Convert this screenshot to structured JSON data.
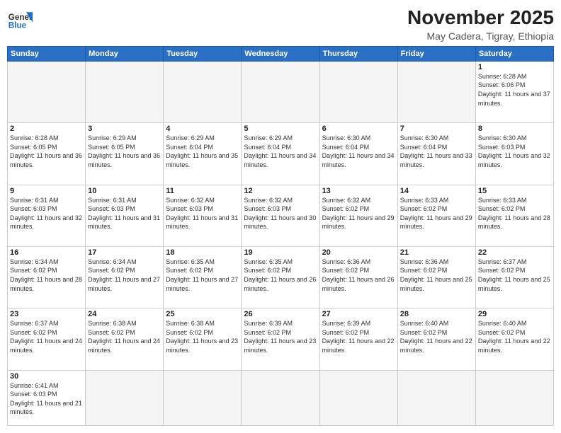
{
  "header": {
    "logo_general": "General",
    "logo_blue": "Blue",
    "month_title": "November 2025",
    "location": "May Cadera, Tigray, Ethiopia"
  },
  "days_of_week": [
    "Sunday",
    "Monday",
    "Tuesday",
    "Wednesday",
    "Thursday",
    "Friday",
    "Saturday"
  ],
  "weeks": [
    [
      null,
      null,
      null,
      null,
      null,
      null,
      {
        "day": "1",
        "sunrise": "Sunrise: 6:28 AM",
        "sunset": "Sunset: 6:06 PM",
        "daylight": "Daylight: 11 hours and 37 minutes."
      }
    ],
    [
      {
        "day": "2",
        "sunrise": "Sunrise: 6:28 AM",
        "sunset": "Sunset: 6:05 PM",
        "daylight": "Daylight: 11 hours and 36 minutes."
      },
      {
        "day": "3",
        "sunrise": "Sunrise: 6:29 AM",
        "sunset": "Sunset: 6:05 PM",
        "daylight": "Daylight: 11 hours and 36 minutes."
      },
      {
        "day": "4",
        "sunrise": "Sunrise: 6:29 AM",
        "sunset": "Sunset: 6:04 PM",
        "daylight": "Daylight: 11 hours and 35 minutes."
      },
      {
        "day": "5",
        "sunrise": "Sunrise: 6:29 AM",
        "sunset": "Sunset: 6:04 PM",
        "daylight": "Daylight: 11 hours and 34 minutes."
      },
      {
        "day": "6",
        "sunrise": "Sunrise: 6:30 AM",
        "sunset": "Sunset: 6:04 PM",
        "daylight": "Daylight: 11 hours and 34 minutes."
      },
      {
        "day": "7",
        "sunrise": "Sunrise: 6:30 AM",
        "sunset": "Sunset: 6:04 PM",
        "daylight": "Daylight: 11 hours and 33 minutes."
      },
      {
        "day": "8",
        "sunrise": "Sunrise: 6:30 AM",
        "sunset": "Sunset: 6:03 PM",
        "daylight": "Daylight: 11 hours and 32 minutes."
      }
    ],
    [
      {
        "day": "9",
        "sunrise": "Sunrise: 6:31 AM",
        "sunset": "Sunset: 6:03 PM",
        "daylight": "Daylight: 11 hours and 32 minutes."
      },
      {
        "day": "10",
        "sunrise": "Sunrise: 6:31 AM",
        "sunset": "Sunset: 6:03 PM",
        "daylight": "Daylight: 11 hours and 31 minutes."
      },
      {
        "day": "11",
        "sunrise": "Sunrise: 6:32 AM",
        "sunset": "Sunset: 6:03 PM",
        "daylight": "Daylight: 11 hours and 31 minutes."
      },
      {
        "day": "12",
        "sunrise": "Sunrise: 6:32 AM",
        "sunset": "Sunset: 6:03 PM",
        "daylight": "Daylight: 11 hours and 30 minutes."
      },
      {
        "day": "13",
        "sunrise": "Sunrise: 6:32 AM",
        "sunset": "Sunset: 6:02 PM",
        "daylight": "Daylight: 11 hours and 29 minutes."
      },
      {
        "day": "14",
        "sunrise": "Sunrise: 6:33 AM",
        "sunset": "Sunset: 6:02 PM",
        "daylight": "Daylight: 11 hours and 29 minutes."
      },
      {
        "day": "15",
        "sunrise": "Sunrise: 6:33 AM",
        "sunset": "Sunset: 6:02 PM",
        "daylight": "Daylight: 11 hours and 28 minutes."
      }
    ],
    [
      {
        "day": "16",
        "sunrise": "Sunrise: 6:34 AM",
        "sunset": "Sunset: 6:02 PM",
        "daylight": "Daylight: 11 hours and 28 minutes."
      },
      {
        "day": "17",
        "sunrise": "Sunrise: 6:34 AM",
        "sunset": "Sunset: 6:02 PM",
        "daylight": "Daylight: 11 hours and 27 minutes."
      },
      {
        "day": "18",
        "sunrise": "Sunrise: 6:35 AM",
        "sunset": "Sunset: 6:02 PM",
        "daylight": "Daylight: 11 hours and 27 minutes."
      },
      {
        "day": "19",
        "sunrise": "Sunrise: 6:35 AM",
        "sunset": "Sunset: 6:02 PM",
        "daylight": "Daylight: 11 hours and 26 minutes."
      },
      {
        "day": "20",
        "sunrise": "Sunrise: 6:36 AM",
        "sunset": "Sunset: 6:02 PM",
        "daylight": "Daylight: 11 hours and 26 minutes."
      },
      {
        "day": "21",
        "sunrise": "Sunrise: 6:36 AM",
        "sunset": "Sunset: 6:02 PM",
        "daylight": "Daylight: 11 hours and 25 minutes."
      },
      {
        "day": "22",
        "sunrise": "Sunrise: 6:37 AM",
        "sunset": "Sunset: 6:02 PM",
        "daylight": "Daylight: 11 hours and 25 minutes."
      }
    ],
    [
      {
        "day": "23",
        "sunrise": "Sunrise: 6:37 AM",
        "sunset": "Sunset: 6:02 PM",
        "daylight": "Daylight: 11 hours and 24 minutes."
      },
      {
        "day": "24",
        "sunrise": "Sunrise: 6:38 AM",
        "sunset": "Sunset: 6:02 PM",
        "daylight": "Daylight: 11 hours and 24 minutes."
      },
      {
        "day": "25",
        "sunrise": "Sunrise: 6:38 AM",
        "sunset": "Sunset: 6:02 PM",
        "daylight": "Daylight: 11 hours and 23 minutes."
      },
      {
        "day": "26",
        "sunrise": "Sunrise: 6:39 AM",
        "sunset": "Sunset: 6:02 PM",
        "daylight": "Daylight: 11 hours and 23 minutes."
      },
      {
        "day": "27",
        "sunrise": "Sunrise: 6:39 AM",
        "sunset": "Sunset: 6:02 PM",
        "daylight": "Daylight: 11 hours and 22 minutes."
      },
      {
        "day": "28",
        "sunrise": "Sunrise: 6:40 AM",
        "sunset": "Sunset: 6:02 PM",
        "daylight": "Daylight: 11 hours and 22 minutes."
      },
      {
        "day": "29",
        "sunrise": "Sunrise: 6:40 AM",
        "sunset": "Sunset: 6:02 PM",
        "daylight": "Daylight: 11 hours and 22 minutes."
      }
    ],
    [
      {
        "day": "30",
        "sunrise": "Sunrise: 6:41 AM",
        "sunset": "Sunset: 6:03 PM",
        "daylight": "Daylight: 11 hours and 21 minutes."
      },
      null,
      null,
      null,
      null,
      null,
      null
    ]
  ]
}
